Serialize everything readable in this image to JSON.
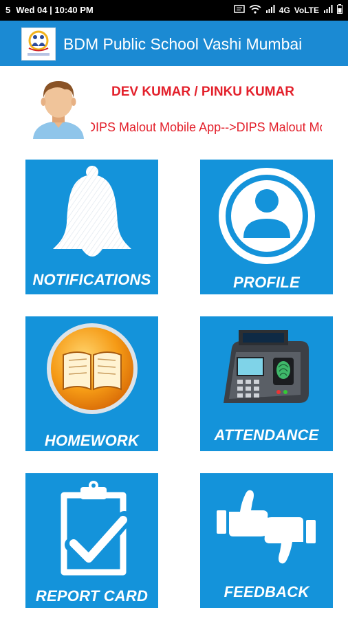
{
  "status_bar": {
    "notification_count": "5",
    "datetime": "Wed 04 | 10:40 PM",
    "network": "4G",
    "volte": "VoLTE"
  },
  "app_bar": {
    "title": "BDM Public School Vashi Mumbai",
    "logo_icon": "school-logo-icon"
  },
  "profile": {
    "name": "DEV KUMAR / PINKU KUMAR",
    "marquee": "DIPS Malout Mobile App-->DIPS Malout Mobile App",
    "avatar_icon": "student-avatar-icon"
  },
  "tiles": [
    {
      "label": "NOTIFICATIONS",
      "icon": "bell-icon"
    },
    {
      "label": "PROFILE",
      "icon": "user-circle-icon"
    },
    {
      "label": "HOMEWORK",
      "icon": "book-icon"
    },
    {
      "label": "ATTENDANCE",
      "icon": "biometric-machine-icon"
    },
    {
      "label": "REPORT CARD",
      "icon": "clipboard-check-icon"
    },
    {
      "label": "FEEDBACK",
      "icon": "thumbs-up-down-icon"
    }
  ],
  "colors": {
    "app_bar": "#1b8ad3",
    "tile": "#1493da",
    "name_text": "#e3202b"
  }
}
